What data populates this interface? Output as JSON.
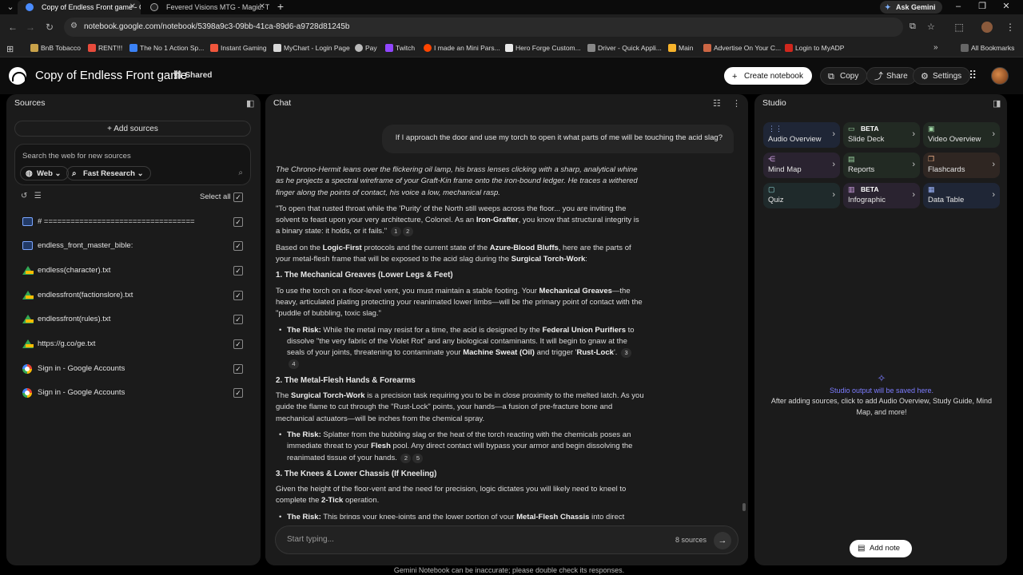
{
  "browser": {
    "tabs": [
      {
        "title": "Copy of Endless Front game - G",
        "active": true
      },
      {
        "title": "Fevered Visions MTG - Magic: T",
        "active": false
      }
    ],
    "ask_gemini": "Ask Gemini",
    "url": "notebook.google.com/notebook/5398a9c3-09bb-41ca-89d6-a9728d81245b",
    "bookmarks": [
      "BnB Tobacco",
      "RENT!!!",
      "The No 1 Action Sp...",
      "Instant Gaming",
      "MyChart - Login Page",
      "Pay",
      "Twitch",
      "I made an Mini Pars...",
      "Hero Forge Custom...",
      "Driver - Quick Appli...",
      "Main",
      "Advertise On Your C...",
      "Login to MyADP"
    ],
    "all_bookmarks": "All Bookmarks"
  },
  "header": {
    "title": "Copy of Endless Front game",
    "shared": "Shared",
    "create_notebook": "Create notebook",
    "copy": "Copy",
    "share": "Share",
    "settings": "Settings"
  },
  "sources": {
    "title": "Sources",
    "add_sources": "Add sources",
    "search_placeholder": "Search the web for new sources",
    "chip_web": "Web",
    "chip_research": "Fast Research",
    "select_all": "Select all",
    "items": [
      {
        "label": "# ==================================",
        "icon": "doc"
      },
      {
        "label": "endless_front_master_bible:",
        "icon": "doc"
      },
      {
        "label": "endless(character).txt",
        "icon": "drive"
      },
      {
        "label": "endlessfront(factionslore).txt",
        "icon": "drive"
      },
      {
        "label": "endlessfront(rules).txt",
        "icon": "drive"
      },
      {
        "label": "https://g.co/ge.txt",
        "icon": "drive"
      },
      {
        "label": "Sign in - Google Accounts",
        "icon": "web"
      },
      {
        "label": "Sign in - Google Accounts",
        "icon": "web"
      }
    ]
  },
  "chat": {
    "title": "Chat",
    "user_message": "If I approach the door and use my torch to open it what parts of me will be touching the acid slag?",
    "narration": "The Chrono-Hermit leans over the flickering oil lamp, his brass lenses clicking with a sharp, analytical whine as he projects a spectral wireframe of your Graft-Kin frame onto the iron-bound ledger. He traces a withered finger along the points of contact, his voice a low, mechanical rasp.",
    "quote": "\"To open that rusted throat while the 'Purity' of the North still weeps across the floor... you are inviting the solvent to feast upon your very architecture, Colonel. As an ",
    "quote_bold": "Iron-Grafter",
    "quote_end": ", you know that structural integrity is a binary state: it holds, or it fails.\"",
    "intro_a": "Based on the ",
    "intro_b1": "Logic-First",
    "intro_c": " protocols and the current state of the ",
    "intro_b2": "Azure-Blood Bluffs",
    "intro_d": ", here are the parts of your metal-flesh frame that will be exposed to the acid slag during the ",
    "intro_b3": "Surgical Torch-Work",
    "intro_e": ":",
    "s1_title": "1. The Mechanical Greaves (Lower Legs & Feet)",
    "s1_a": "To use the torch on a floor-level vent, you must maintain a stable footing. Your ",
    "s1_b": "Mechanical Greaves",
    "s1_c": "—the heavy, articulated plating protecting your reanimated lower limbs—will be the primary point of contact with the \"puddle of bubbling, toxic slag.\"",
    "s1_risk_label": "The Risk:",
    "s1_risk_a": " While the metal may resist for a time, the acid is designed by the ",
    "s1_risk_b": "Federal Union Purifiers",
    "s1_risk_c": " to dissolve \"the very fabric of the Violet Rot\" and any biological contaminants. It will begin to gnaw at the seals of your joints, threatening to contaminate your ",
    "s1_risk_d": "Machine Sweat (Oil)",
    "s1_risk_e": " and trigger '",
    "s1_risk_f": "Rust-Lock",
    "s1_risk_g": "'.",
    "s2_title": "2. The Metal-Flesh Hands & Forearms",
    "s2_a": "The ",
    "s2_b": "Surgical Torch-Work",
    "s2_c": " is a precision task requiring you to be in close proximity to the melted latch. As you guide the flame to cut through the \"Rust-Lock\" points, your hands—a fusion of pre-fracture bone and mechanical actuators—will be inches from the chemical spray.",
    "s2_risk_label": "The Risk:",
    "s2_risk_a": " Splatter from the bubbling slag or the heat of the torch reacting with the chemicals poses an immediate threat to your ",
    "s2_risk_b": "Flesh",
    "s2_risk_c": " pool. Any direct contact will bypass your armor and begin dissolving the reanimated tissue of your hands.",
    "s3_title": "3. The Knees & Lower Chassis (If Kneeling)",
    "s3_a": "Given the height of the floor-vent and the need for precision, logic dictates you will likely need to kneel to complete the ",
    "s3_b": "2-Tick",
    "s3_c": " operation.",
    "s3_risk_label": "The Risk:",
    "s3_risk_a": " This brings your knee-joints and the lower portion of your ",
    "s3_risk_b": "Metal-Flesh Chassis",
    "s3_risk_c": " into direct",
    "cites": [
      "1",
      "2",
      "3",
      "4",
      "2",
      "5"
    ],
    "input_placeholder": "Start typing...",
    "source_count": "8 sources",
    "disclaimer": "Gemini Notebook can be inaccurate; please double check its responses."
  },
  "studio": {
    "title": "Studio",
    "tiles": [
      {
        "label": "Audio Overview",
        "color": "blue",
        "icon": "audio-icon",
        "beta": ""
      },
      {
        "label": "Slide Deck",
        "color": "green",
        "icon": "slides-icon",
        "beta": "BETA"
      },
      {
        "label": "Video Overview",
        "color": "green",
        "icon": "video-icon",
        "beta": ""
      },
      {
        "label": "Mind Map",
        "color": "purple",
        "icon": "mindmap-icon",
        "beta": ""
      },
      {
        "label": "Reports",
        "color": "green",
        "icon": "reports-icon",
        "beta": ""
      },
      {
        "label": "Flashcards",
        "color": "orange",
        "icon": "flashcards-icon",
        "beta": ""
      },
      {
        "label": "Quiz",
        "color": "teal",
        "icon": "quiz-icon",
        "beta": ""
      },
      {
        "label": "Infographic",
        "color": "purple",
        "icon": "infographic-icon",
        "beta": "BETA"
      },
      {
        "label": "Data Table",
        "color": "blue",
        "icon": "table-icon",
        "beta": ""
      }
    ],
    "empty_title": "Studio output will be saved here.",
    "empty_desc": "After adding sources, click to add Audio Overview, Study Guide, Mind Map, and more!",
    "add_note": "Add note"
  }
}
